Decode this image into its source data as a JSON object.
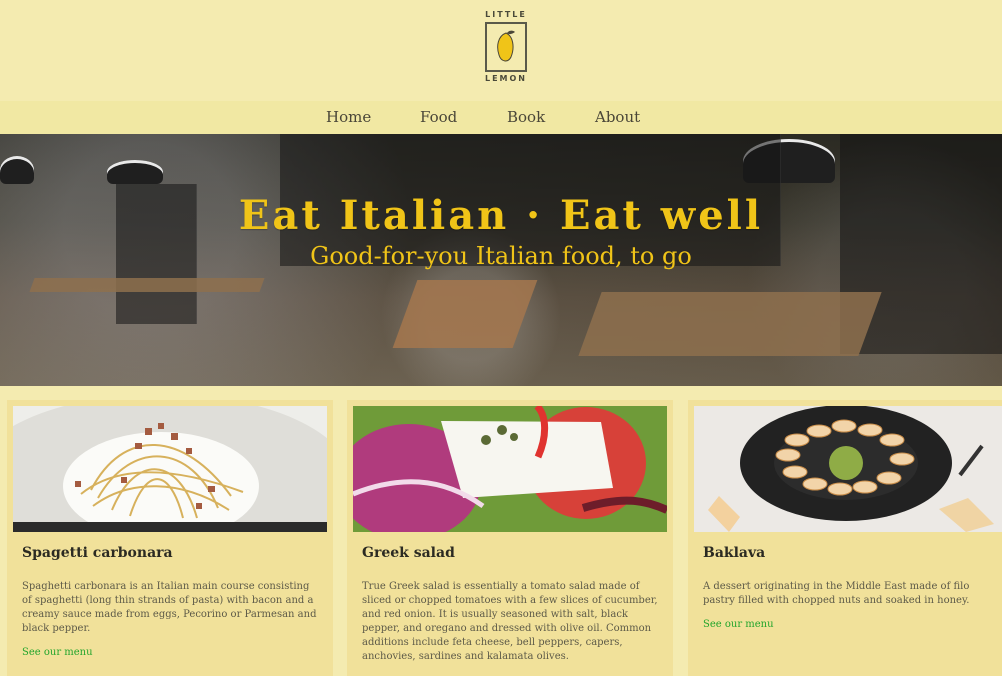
{
  "logo": {
    "top_text": "LITTLE",
    "bottom_text": "LEMON"
  },
  "nav": {
    "items": [
      {
        "label": "Home"
      },
      {
        "label": "Food"
      },
      {
        "label": "Book"
      },
      {
        "label": "About"
      }
    ]
  },
  "hero": {
    "title": "Eat Italian · Eat well",
    "subtitle": "Good-for-you Italian food, to go"
  },
  "cards": [
    {
      "title": "Spagetti carbonara",
      "description": "Spaghetti carbonara is an Italian main course consisting of spaghetti (long thin strands of pasta) with bacon and a creamy sauce made from eggs, Pecorino or Parmesan and black pepper.",
      "link": "See our menu"
    },
    {
      "title": "Greek salad",
      "description": "True Greek salad is essentially a tomato salad made of sliced or chopped tomatoes with a few slices of cucumber, and red onion. It is usually seasoned with salt, black pepper, and oregano and dressed with olive oil. Common additions include feta cheese, bell peppers, capers, anchovies, sardines and kalamata olives.",
      "link": null
    },
    {
      "title": "Baklava",
      "description": "A dessert originating in the Middle East made of filo pastry filled with chopped nuts and soaked in honey.",
      "link": "See our menu"
    }
  ],
  "colors": {
    "background": "#f4ebb0",
    "nav_background": "#f1e8a3",
    "accent_yellow": "#f0c418",
    "link_green": "#23a52c",
    "card_background": "#f1e19a"
  },
  "icons": {
    "logo": "lemon-icon"
  }
}
